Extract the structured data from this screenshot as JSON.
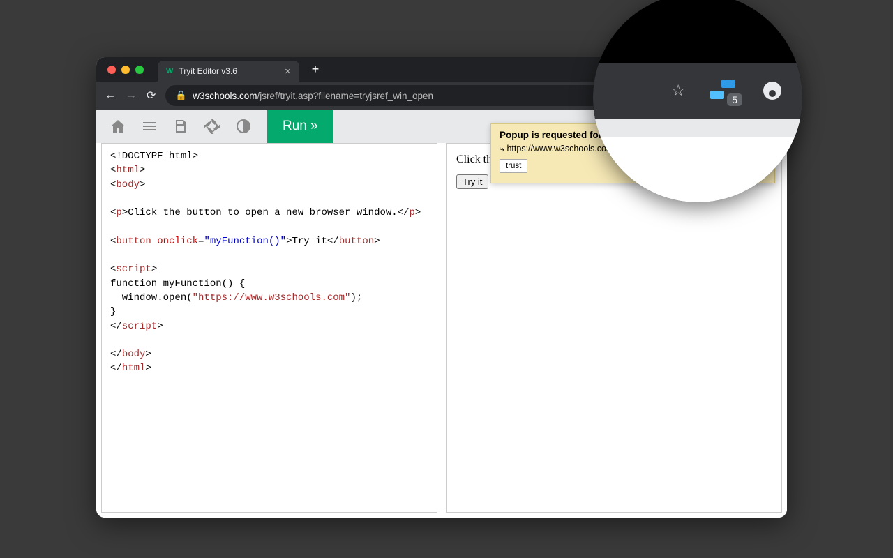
{
  "browser": {
    "tab_title": "Tryit Editor v3.6",
    "url_domain": "w3schools.com",
    "url_path": "/jsref/tryit.asp?filename=tryjsref_win_open"
  },
  "editor": {
    "run_label": "Run »"
  },
  "code": {
    "doctype": "<!DOCTYPE html>",
    "html_open": "html",
    "body_open": "body",
    "p_text": "Click the button to open a new browser window.",
    "p_close": "p",
    "button_tag": "button",
    "onclick_attr": "onclick",
    "onclick_val": "\"myFunction()\"",
    "button_text": "Try it",
    "script_tag": "script",
    "fn_decl": "function myFunction() {",
    "fn_body_pre": "  window.open(",
    "fn_url": "\"https://www.w3schools.com\"",
    "fn_body_post": ");",
    "fn_close": "}",
    "body_close": "body",
    "html_close": "html"
  },
  "output": {
    "paragraph": "Click the",
    "try_it": "Try it"
  },
  "popup": {
    "title": "Popup is requested for",
    "url": "https://www.w3schools.com",
    "trust_label": "trust"
  },
  "magnifier": {
    "badge_count": "5"
  }
}
